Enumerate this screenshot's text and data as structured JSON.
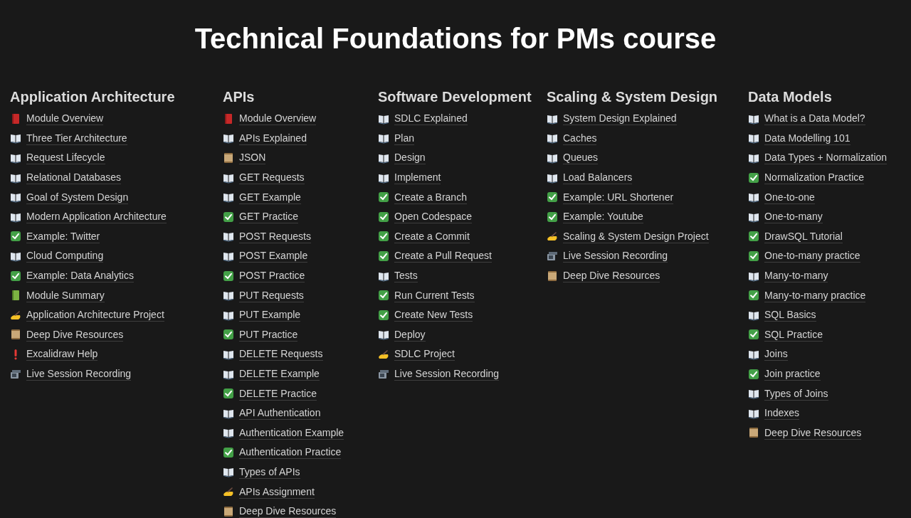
{
  "title": "Technical Foundations for PMs course",
  "columns": [
    {
      "heading": "Application Architecture",
      "items": [
        {
          "kind": "overview",
          "label": "Module Overview"
        },
        {
          "kind": "reading",
          "label": "Three Tier Architecture"
        },
        {
          "kind": "reading",
          "label": "Request Lifecycle"
        },
        {
          "kind": "reading",
          "label": "Relational Databases"
        },
        {
          "kind": "reading",
          "label": "Goal of System Design"
        },
        {
          "kind": "reading",
          "label": "Modern Application Architecture"
        },
        {
          "kind": "exercise",
          "label": "Example: Twitter"
        },
        {
          "kind": "reading",
          "label": "Cloud Computing"
        },
        {
          "kind": "exercise",
          "label": "Example: Data Analytics"
        },
        {
          "kind": "summary",
          "label": "Module Summary"
        },
        {
          "kind": "project",
          "label": "Application Architecture Project"
        },
        {
          "kind": "resource",
          "label": "Deep Dive Resources"
        },
        {
          "kind": "alert",
          "label": "Excalidraw Help"
        },
        {
          "kind": "recording",
          "label": "Live Session Recording"
        }
      ]
    },
    {
      "heading": "APIs",
      "items": [
        {
          "kind": "overview",
          "label": "Module Overview"
        },
        {
          "kind": "reading",
          "label": "APIs Explained"
        },
        {
          "kind": "resource",
          "label": "JSON"
        },
        {
          "kind": "reading",
          "label": "GET Requests"
        },
        {
          "kind": "reading",
          "label": "GET Example"
        },
        {
          "kind": "exercise",
          "label": "GET Practice"
        },
        {
          "kind": "reading",
          "label": "POST Requests"
        },
        {
          "kind": "reading",
          "label": "POST Example"
        },
        {
          "kind": "exercise",
          "label": "POST Practice"
        },
        {
          "kind": "reading",
          "label": "PUT Requests"
        },
        {
          "kind": "reading",
          "label": "PUT Example"
        },
        {
          "kind": "exercise",
          "label": "PUT Practice"
        },
        {
          "kind": "reading",
          "label": "DELETE Requests"
        },
        {
          "kind": "reading",
          "label": "DELETE Example"
        },
        {
          "kind": "exercise",
          "label": "DELETE Practice"
        },
        {
          "kind": "reading",
          "label": "API Authentication"
        },
        {
          "kind": "reading",
          "label": "Authentication Example"
        },
        {
          "kind": "exercise",
          "label": "Authentication Practice"
        },
        {
          "kind": "reading",
          "label": "Types of APIs"
        },
        {
          "kind": "project",
          "label": "APIs Assignment"
        },
        {
          "kind": "resource",
          "label": "Deep Dive Resources"
        }
      ]
    },
    {
      "heading": "Software Development",
      "items": [
        {
          "kind": "reading",
          "label": "SDLC Explained"
        },
        {
          "kind": "reading",
          "label": "Plan"
        },
        {
          "kind": "reading",
          "label": "Design"
        },
        {
          "kind": "reading",
          "label": "Implement"
        },
        {
          "kind": "exercise",
          "label": "Create a Branch"
        },
        {
          "kind": "exercise",
          "label": "Open Codespace"
        },
        {
          "kind": "exercise",
          "label": "Create a Commit"
        },
        {
          "kind": "exercise",
          "label": "Create a Pull Request"
        },
        {
          "kind": "reading",
          "label": "Tests"
        },
        {
          "kind": "exercise",
          "label": "Run Current Tests"
        },
        {
          "kind": "exercise",
          "label": "Create New Tests"
        },
        {
          "kind": "reading",
          "label": "Deploy"
        },
        {
          "kind": "project",
          "label": "SDLC Project"
        },
        {
          "kind": "recording",
          "label": "Live Session Recording"
        }
      ]
    },
    {
      "heading": "Scaling & System Design",
      "items": [
        {
          "kind": "reading",
          "label": "System Design Explained"
        },
        {
          "kind": "reading",
          "label": "Caches"
        },
        {
          "kind": "reading",
          "label": "Queues"
        },
        {
          "kind": "reading",
          "label": "Load Balancers"
        },
        {
          "kind": "exercise",
          "label": "Example: URL Shortener"
        },
        {
          "kind": "exercise",
          "label": "Example: Youtube"
        },
        {
          "kind": "project",
          "label": "Scaling & System Design Project"
        },
        {
          "kind": "recording",
          "label": "Live Session Recording"
        },
        {
          "kind": "resource",
          "label": "Deep Dive Resources"
        }
      ]
    },
    {
      "heading": "Data Models",
      "items": [
        {
          "kind": "reading",
          "label": "What is a Data Model?"
        },
        {
          "kind": "reading",
          "label": "Data Modelling 101"
        },
        {
          "kind": "reading",
          "label": "Data Types + Normalization"
        },
        {
          "kind": "exercise",
          "label": "Normalization Practice"
        },
        {
          "kind": "reading",
          "label": "One-to-one"
        },
        {
          "kind": "reading",
          "label": "One-to-many"
        },
        {
          "kind": "exercise",
          "label": "DrawSQL Tutorial"
        },
        {
          "kind": "exercise",
          "label": "One-to-many practice"
        },
        {
          "kind": "reading",
          "label": "Many-to-many"
        },
        {
          "kind": "exercise",
          "label": "Many-to-many practice"
        },
        {
          "kind": "reading",
          "label": "SQL Basics"
        },
        {
          "kind": "exercise",
          "label": "SQL Practice"
        },
        {
          "kind": "reading",
          "label": "Joins"
        },
        {
          "kind": "exercise",
          "label": "Join practice"
        },
        {
          "kind": "reading",
          "label": "Types of Joins"
        },
        {
          "kind": "reading",
          "label": "Indexes"
        },
        {
          "kind": "resource",
          "label": "Deep Dive Resources"
        }
      ]
    }
  ]
}
